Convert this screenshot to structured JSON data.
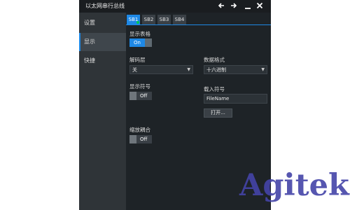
{
  "window": {
    "title": "以太网串行总线",
    "controls": [
      "back-arrow-icon",
      "forward-arrow-icon",
      "minimize-icon",
      "close-icon"
    ],
    "accent_color": "#1e88e5"
  },
  "sidebar": {
    "items": [
      {
        "label": "设置",
        "active": false
      },
      {
        "label": "显示",
        "active": true
      },
      {
        "label": "快捷",
        "active": false
      }
    ]
  },
  "tabs": [
    {
      "label": "SB1",
      "active": true
    },
    {
      "label": "SB2",
      "active": false
    },
    {
      "label": "SB3",
      "active": false
    },
    {
      "label": "SB4",
      "active": false
    }
  ],
  "display": {
    "show_table": {
      "label": "显示表格",
      "state": "On"
    },
    "decode_layer": {
      "label": "解码层",
      "value": "关"
    },
    "data_format": {
      "label": "数据格式",
      "value": "十六进制"
    },
    "show_symbols": {
      "label": "显示符号",
      "state": "Off"
    },
    "load_symbols": {
      "label": "载入符号",
      "file_value": "FileName",
      "open_button": "打开..."
    },
    "zoom_coupling": {
      "label": "缩放耦合",
      "state": "Off"
    }
  },
  "watermark": "Agitek"
}
